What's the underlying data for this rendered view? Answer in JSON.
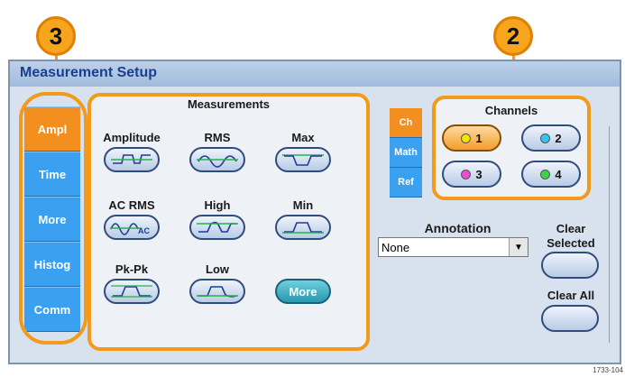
{
  "callouts": {
    "left": "3",
    "right": "2"
  },
  "window": {
    "title": "Measurement Setup"
  },
  "sidebar": {
    "tabs": [
      "Ampl",
      "Time",
      "More",
      "Histog",
      "Comm"
    ],
    "active": "Ampl"
  },
  "measurements": {
    "header": "Measurements",
    "items": [
      {
        "label": "Amplitude",
        "icon": "amplitude-waveform-icon"
      },
      {
        "label": "RMS",
        "icon": "rms-waveform-icon"
      },
      {
        "label": "Max",
        "icon": "max-waveform-icon"
      },
      {
        "label": "AC RMS",
        "icon": "ac-rms-waveform-icon",
        "icon_text": "AC"
      },
      {
        "label": "High",
        "icon": "high-waveform-icon"
      },
      {
        "label": "Min",
        "icon": "min-waveform-icon"
      },
      {
        "label": "Pk-Pk",
        "icon": "pk-pk-waveform-icon"
      },
      {
        "label": "Low",
        "icon": "low-waveform-icon"
      }
    ],
    "more_label": "More"
  },
  "source_tabs": {
    "tabs": [
      "Ch",
      "Math",
      "Ref"
    ],
    "active": "Ch"
  },
  "channels": {
    "header": "Channels",
    "buttons": [
      {
        "label": "1",
        "color": "#f2e500",
        "selected": true
      },
      {
        "label": "2",
        "color": "#33c6f0",
        "selected": false
      },
      {
        "label": "3",
        "color": "#e84fd2",
        "selected": false
      },
      {
        "label": "4",
        "color": "#3fd14a",
        "selected": false
      }
    ]
  },
  "annotation": {
    "label": "Annotation",
    "value": "None",
    "arrow": "▼"
  },
  "clear_selected": {
    "line1": "Clear",
    "line2": "Selected"
  },
  "clear_all": {
    "label": "Clear All"
  },
  "figure_id": "1733-104"
}
